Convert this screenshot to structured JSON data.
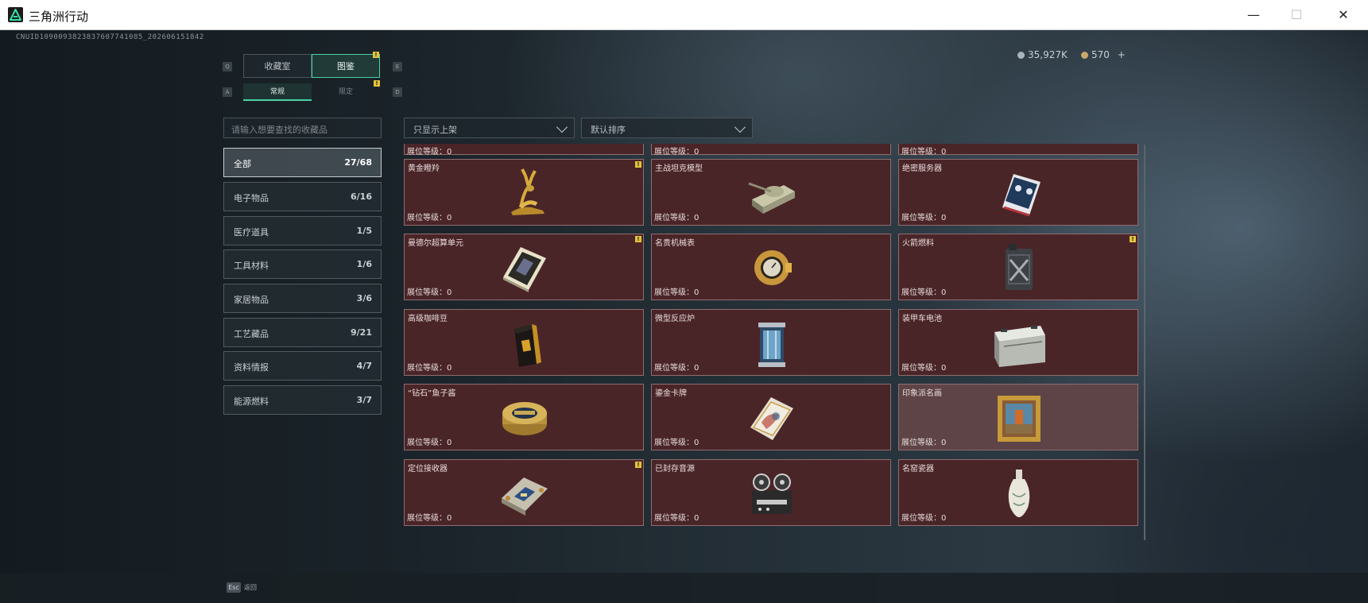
{
  "window": {
    "title": "三角洲行动",
    "minimize": "—",
    "maximize": "☐",
    "close": "✕"
  },
  "header": {
    "uid": "CNUID1090093823837607741085_202606151842",
    "currency1": "35,927K",
    "currency2": "570",
    "add": "+"
  },
  "keys": {
    "q": "Q",
    "e": "E",
    "a": "A",
    "d": "D"
  },
  "tabs": {
    "main": [
      "收藏室",
      "图鉴"
    ],
    "sub": [
      "常规",
      "限定"
    ],
    "alert": "!"
  },
  "search": {
    "placeholder": "请输入想要查找的收藏品"
  },
  "filters": {
    "display": "只显示上架",
    "sort": "默认排序"
  },
  "categories": [
    {
      "label": "全部",
      "count": "27/68"
    },
    {
      "label": "电子物品",
      "count": "6/16"
    },
    {
      "label": "医疗道具",
      "count": "1/5"
    },
    {
      "label": "工具材料",
      "count": "1/6"
    },
    {
      "label": "家居物品",
      "count": "3/6"
    },
    {
      "label": "工艺藏品",
      "count": "9/21"
    },
    {
      "label": "资料情报",
      "count": "4/7"
    },
    {
      "label": "能源燃料",
      "count": "3/7"
    }
  ],
  "level_label": "展位等级：0",
  "items": [
    {
      "name": "黄金瞪羚",
      "alert": true,
      "icon": "gold-gazelle-icon"
    },
    {
      "name": "主战坦克模型",
      "alert": false,
      "icon": "tank-model-icon"
    },
    {
      "name": "绝密服务器",
      "alert": false,
      "icon": "server-icon"
    },
    {
      "name": "曼德尔超算单元",
      "alert": true,
      "icon": "supercompute-unit-icon"
    },
    {
      "name": "名贵机械表",
      "alert": false,
      "icon": "watch-icon"
    },
    {
      "name": "火箭燃料",
      "alert": true,
      "icon": "fuel-canister-icon"
    },
    {
      "name": "高级咖啡豆",
      "alert": false,
      "icon": "coffee-bag-icon"
    },
    {
      "name": "微型反应炉",
      "alert": false,
      "icon": "reactor-icon"
    },
    {
      "name": "装甲车电池",
      "alert": false,
      "icon": "battery-icon"
    },
    {
      "name": "“钻石”鱼子酱",
      "alert": false,
      "icon": "caviar-tin-icon"
    },
    {
      "name": "鎏金卡牌",
      "alert": false,
      "icon": "gilded-card-icon"
    },
    {
      "name": "印象派名画",
      "alert": false,
      "icon": "painting-icon"
    },
    {
      "name": "定位接收器",
      "alert": true,
      "icon": "locator-receiver-icon"
    },
    {
      "name": "已封存音源",
      "alert": false,
      "icon": "tape-recorder-icon"
    },
    {
      "name": "名窑瓷器",
      "alert": false,
      "icon": "porcelain-vase-icon"
    }
  ],
  "footer": {
    "key": "Esc",
    "label": "返回"
  }
}
